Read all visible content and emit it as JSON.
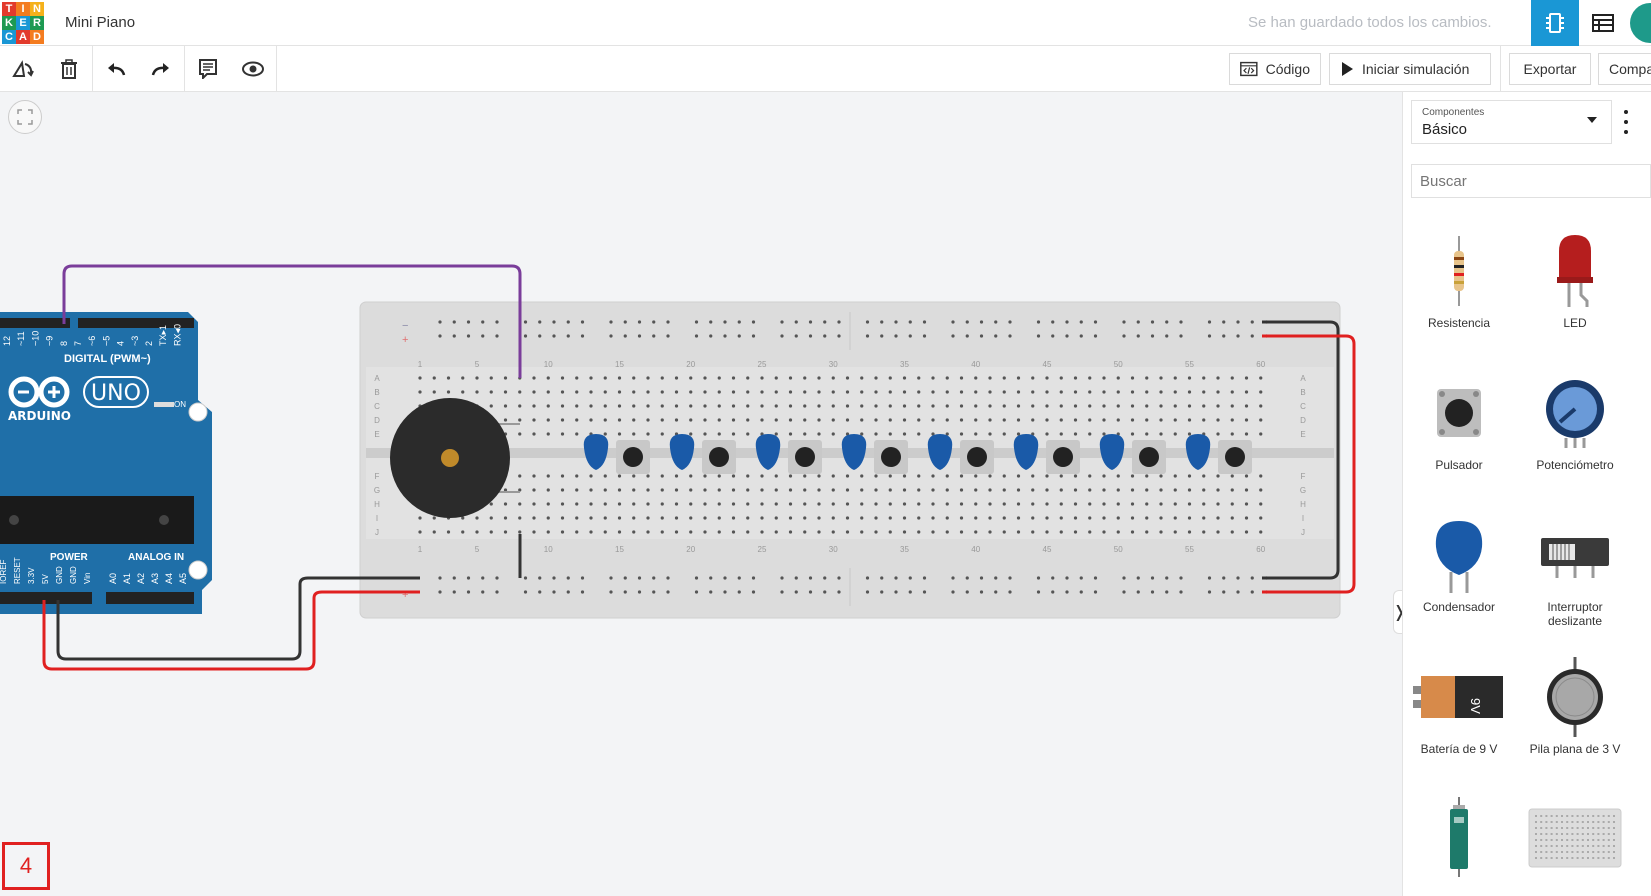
{
  "header": {
    "logo_letters": [
      "T",
      "I",
      "N",
      "K",
      "E",
      "R",
      "C",
      "A",
      "D"
    ],
    "logo_colors": [
      "#e23a2c",
      "#f47c20",
      "#f5b11a",
      "#1e9a52",
      "#1a97d5",
      "#1e9a52",
      "#1a97d5",
      "#e23a2c",
      "#f47c20"
    ],
    "title": "Mini Piano",
    "save_status": "Se han guardado todos los cambios.",
    "circuit_view_icon": "circuit-icon",
    "list_view_icon": "list-icon"
  },
  "toolbar": {
    "rotate": "rotate-icon",
    "delete": "trash-icon",
    "undo": "undo-icon",
    "redo": "redo-icon",
    "notes": "notes-icon",
    "view": "eye-icon",
    "code_label": "Código",
    "simulate_label": "Iniciar simulación",
    "export_label": "Exportar",
    "share_label": "Compartir"
  },
  "canvas": {
    "page_number": "4",
    "arduino": {
      "digital_label": "DIGITAL (PWM~)",
      "brand": "ARDUINO",
      "model": "UNO",
      "on_label": "ON",
      "power_label": "POWER",
      "analog_label": "ANALOG IN",
      "top_pins": [
        "12",
        "~11",
        "~10",
        "~9",
        "8",
        "7",
        "~6",
        "~5",
        "4",
        "~3",
        "2",
        "TX▸1",
        "RX◂0"
      ],
      "power_pins": [
        "IOREF",
        "RESET",
        "3.3V",
        "5V",
        "GND",
        "GND",
        "Vin"
      ],
      "analog_pins": [
        "A0",
        "A1",
        "A2",
        "A3",
        "A4",
        "A5"
      ]
    },
    "breadboard": {
      "column_numbers": [
        "1",
        "5",
        "10",
        "15",
        "20",
        "25",
        "30",
        "35",
        "40",
        "45",
        "50",
        "55",
        "60"
      ],
      "row_letters_top": [
        "A",
        "B",
        "C",
        "D",
        "E"
      ],
      "row_letters_bottom": [
        "F",
        "G",
        "H",
        "I",
        "J"
      ]
    },
    "colors": {
      "wire_purple": "#7a3d9a",
      "wire_red": "#e02020",
      "wire_black": "#333333",
      "arduino_blue": "#1f6fa8",
      "capacitor_blue": "#1a5aa8"
    }
  },
  "panel": {
    "components_label": "Componentes",
    "components_value": "Básico",
    "search_placeholder": "Buscar",
    "items": [
      {
        "label": "Resistencia"
      },
      {
        "label": "LED"
      },
      {
        "label": "Pulsador"
      },
      {
        "label": "Potenciómetro"
      },
      {
        "label": "Condensador"
      },
      {
        "label": "Interruptor deslizante"
      },
      {
        "label": "Batería de 9 V"
      },
      {
        "label": "Pila plana de 3 V"
      },
      {
        "label": ""
      },
      {
        "label": ""
      }
    ]
  }
}
